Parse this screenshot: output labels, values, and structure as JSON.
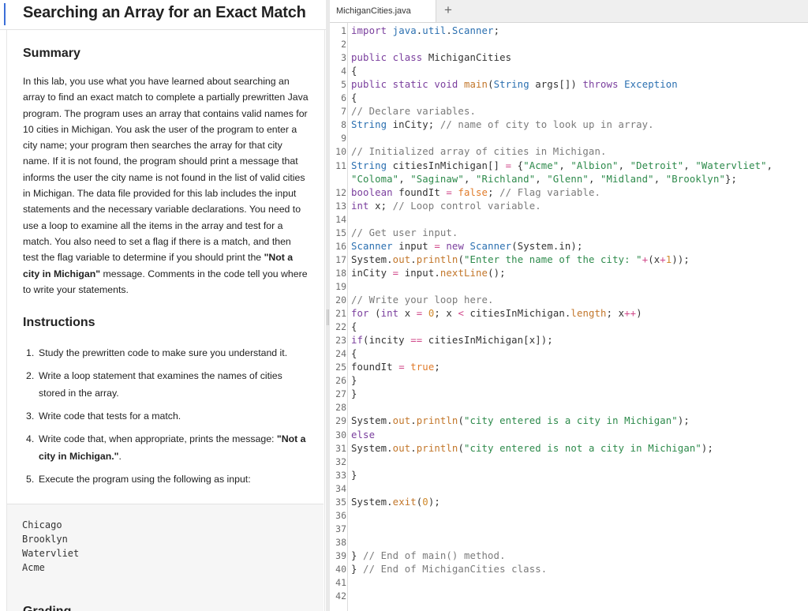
{
  "left_panel": {
    "title": "Searching an Array for an Exact Match",
    "summary_heading": "Summary",
    "summary_text_1": "In this lab, you use what you have learned about searching an array to find an exact match to complete a partially prewritten Java program. The program uses an array that contains valid names for 10 cities in Michigan. You ask the user of the program to enter a city name; your program then searches the array for that city name. If it is not found, the program should print a message that informs the user the city name is not found in the list of valid cities in Michigan. The data file provided for this lab includes the input statements and the necessary variable declarations. You need to use a loop to examine all the items in the array and test for a match. You also need to set a flag if there is a match, and then test the flag variable to determine if you should print the ",
    "summary_bold": "\"Not a city in Michigan\"",
    "summary_text_2": " message. Comments in the code tell you where to write your statements.",
    "instructions_heading": "Instructions",
    "steps": [
      {
        "num": "1.",
        "text": "Study the prewritten code to make sure you understand it."
      },
      {
        "num": "2.",
        "text": "Write a loop statement that examines the names of cities stored in the array."
      },
      {
        "num": "3.",
        "text": "Write code that tests for a match."
      },
      {
        "num": "4.",
        "text": "Write code that, when appropriate, prints the message: ",
        "bold": "\"Not a city in Michigan.\"",
        "after": "."
      },
      {
        "num": "5.",
        "text": "Execute the program using the following as input:"
      }
    ],
    "input_lines": [
      "Chicago",
      "Brooklyn",
      "Watervliet",
      "Acme"
    ],
    "next_heading_partial": "Grading"
  },
  "editor": {
    "tab_label": "MichiganCities.java",
    "add_tab_glyph": "+",
    "line_count": 42,
    "lines": [
      {
        "n": "1",
        "code": "import java.util.Scanner;"
      },
      {
        "n": "2",
        "code": ""
      },
      {
        "n": "3",
        "code": "public class MichiganCities"
      },
      {
        "n": "4",
        "code": "{"
      },
      {
        "n": "5",
        "code": "public static void main(String args[]) throws Exception"
      },
      {
        "n": "6",
        "code": "{"
      },
      {
        "n": "7",
        "code": "// Declare variables."
      },
      {
        "n": "8",
        "code": "String inCity; // name of city to look up in array."
      },
      {
        "n": "9",
        "code": ""
      },
      {
        "n": "10",
        "code": "// Initialized array of cities in Michigan."
      },
      {
        "n": "11",
        "code": "String citiesInMichigan[] = {\"Acme\", \"Albion\", \"Detroit\", \"Watervliet\","
      },
      {
        "n": "",
        "code": "\"Coloma\", \"Saginaw\", \"Richland\", \"Glenn\", \"Midland\", \"Brooklyn\"};"
      },
      {
        "n": "12",
        "code": "boolean foundIt = false; // Flag variable."
      },
      {
        "n": "13",
        "code": "int x; // Loop control variable."
      },
      {
        "n": "14",
        "code": ""
      },
      {
        "n": "15",
        "code": "// Get user input."
      },
      {
        "n": "16",
        "code": "Scanner input = new Scanner(System.in);"
      },
      {
        "n": "17",
        "code": "System.out.println(\"Enter the name of the city: \"+(x+1));"
      },
      {
        "n": "18",
        "code": "inCity = input.nextLine();"
      },
      {
        "n": "19",
        "code": ""
      },
      {
        "n": "20",
        "code": "// Write your loop here."
      },
      {
        "n": "21",
        "code": "for (int x = 0; x < citiesInMichigan.length; x++)"
      },
      {
        "n": "22",
        "code": "{"
      },
      {
        "n": "23",
        "code": "if(incity == citiesInMichigan[x]);"
      },
      {
        "n": "24",
        "code": "{"
      },
      {
        "n": "25",
        "code": "foundIt = true;"
      },
      {
        "n": "26",
        "code": "}"
      },
      {
        "n": "27",
        "code": "}"
      },
      {
        "n": "28",
        "code": ""
      },
      {
        "n": "29",
        "code": "System.out.println(\"city entered is a city in Michigan\");"
      },
      {
        "n": "30",
        "code": "else"
      },
      {
        "n": "31",
        "code": "System.out.println(\"city entered is not a city in Michigan\");"
      },
      {
        "n": "32",
        "code": ""
      },
      {
        "n": "33",
        "code": "}"
      },
      {
        "n": "34",
        "code": ""
      },
      {
        "n": "35",
        "code": "System.exit(0);"
      },
      {
        "n": "36",
        "code": ""
      },
      {
        "n": "37",
        "code": ""
      },
      {
        "n": "38",
        "code": ""
      },
      {
        "n": "39",
        "code": "} // End of main() method."
      },
      {
        "n": "40",
        "code": "} // End of MichiganCities class."
      },
      {
        "n": "41",
        "code": ""
      },
      {
        "n": "42",
        "code": ""
      }
    ]
  },
  "colors": {
    "keyword": "#7a3e9d",
    "type": "#2a6fb0",
    "comment": "#7a7a7a",
    "string": "#2d8a4b",
    "number": "#d08a2c",
    "accent": "#3c6fd8"
  }
}
